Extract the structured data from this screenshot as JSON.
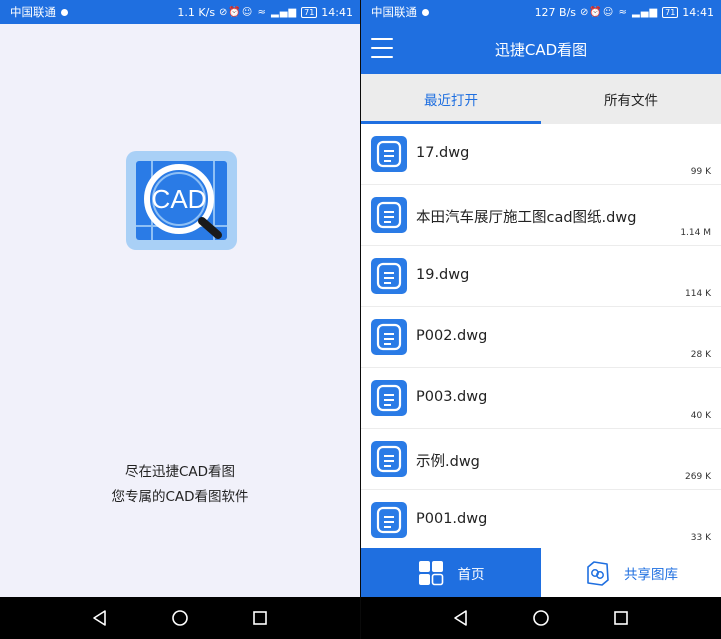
{
  "status_left": {
    "carrier": "中国联通",
    "speed": "1.1 K/s",
    "battery": "71",
    "time": "14:41"
  },
  "status_right": {
    "carrier": "中国联通",
    "speed": "127 B/s",
    "battery": "71",
    "time": "14:41"
  },
  "splash": {
    "logo_text": "CAD",
    "line1": "尽在迅捷CAD看图",
    "line2": "您专属的CAD看图软件"
  },
  "app": {
    "title": "迅捷CAD看图",
    "tabs": [
      {
        "label": "最近打开",
        "active": true
      },
      {
        "label": "所有文件",
        "active": false
      }
    ],
    "files": [
      {
        "name": "17.dwg",
        "size": "99 K"
      },
      {
        "name": "本田汽车展厅施工图cad图纸.dwg",
        "size": "1.14 M"
      },
      {
        "name": "19.dwg",
        "size": "114 K"
      },
      {
        "name": "P002.dwg",
        "size": "28 K"
      },
      {
        "name": "P003.dwg",
        "size": "40 K"
      },
      {
        "name": "示例.dwg",
        "size": "269 K"
      },
      {
        "name": "P001.dwg",
        "size": "33 K"
      }
    ],
    "bottom_tabs": {
      "home": "首页",
      "share": "共享图库"
    }
  },
  "colors": {
    "primary": "#1f6fe0",
    "splash_bg": "#f1f1fa",
    "tab_bg": "#ececec"
  }
}
